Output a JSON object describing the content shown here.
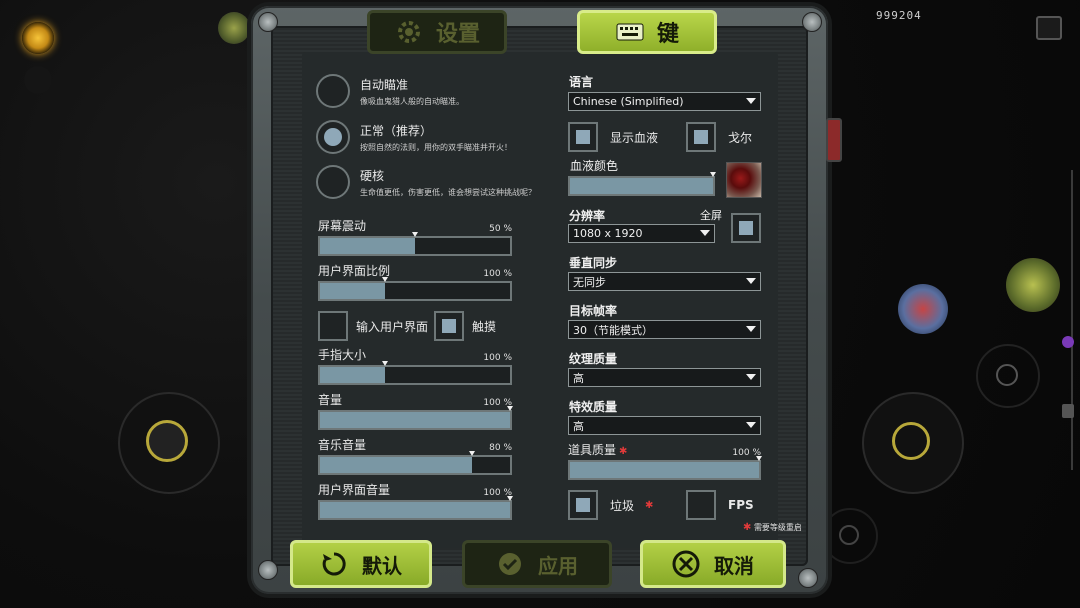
{
  "hud": {
    "score": "999204"
  },
  "tabs": {
    "settings_label": "设置",
    "keys_label": "键"
  },
  "aim_modes": [
    {
      "title": "自动瞄准",
      "desc": "像吸血鬼猎人般的自动瞄准。",
      "selected": false
    },
    {
      "title": "正常（推荐）",
      "desc": "按照自然的法则，用你的双手瞄准并开火！",
      "selected": true
    },
    {
      "title": "硬核",
      "desc": "生命值更低，伤害更低，谁会想尝试这种挑战呢？",
      "selected": false
    }
  ],
  "sliders": [
    {
      "label": "屏幕震动",
      "value_text": "50 %",
      "fill": 0.5
    },
    {
      "label": "用户界面比例",
      "value_text": "100 %",
      "fill": 0.34
    },
    {
      "label": "手指大小",
      "value_text": "100 %",
      "fill": 0.34
    },
    {
      "label": "音量",
      "value_text": "100 %",
      "fill": 1.0
    },
    {
      "label": "音乐音量",
      "value_text": "80 %",
      "fill": 0.8
    },
    {
      "label": "用户界面音量",
      "value_text": "100 %",
      "fill": 1.0
    }
  ],
  "input_ui": {
    "label": "输入用户界面",
    "checked": false
  },
  "touch": {
    "label": "触摸",
    "checked": true
  },
  "language": {
    "label": "语言",
    "value": "Chinese (Simplified)"
  },
  "show_blood": {
    "label": "显示血液",
    "checked": true
  },
  "gore": {
    "label": "戈尔",
    "checked": true
  },
  "blood_color": {
    "label": "血液颜色"
  },
  "resolution": {
    "label": "分辨率",
    "value": "1080 x 1920",
    "fullscreen_label": "全屏",
    "fullscreen_checked": true
  },
  "vsync": {
    "label": "垂直同步",
    "value": "无同步"
  },
  "target_fps": {
    "label": "目标帧率",
    "value": "30（节能模式）"
  },
  "texture_quality": {
    "label": "纹理质量",
    "value": "高"
  },
  "effects_quality": {
    "label": "特效质量",
    "value": "高"
  },
  "item_quality": {
    "label": "道具质量",
    "value_text": "100 %",
    "fill": 1.0
  },
  "garbage": {
    "label": "垃圾",
    "checked": true
  },
  "fps": {
    "label": "FPS",
    "checked": false
  },
  "restart_note": "需要等级重启",
  "buttons": {
    "default_label": "默认",
    "apply_label": "应用",
    "cancel_label": "取消"
  },
  "colors": {
    "accent_green": "#a4c23a",
    "fill_blue": "#7a97a4",
    "required_red": "#e03a3a"
  }
}
